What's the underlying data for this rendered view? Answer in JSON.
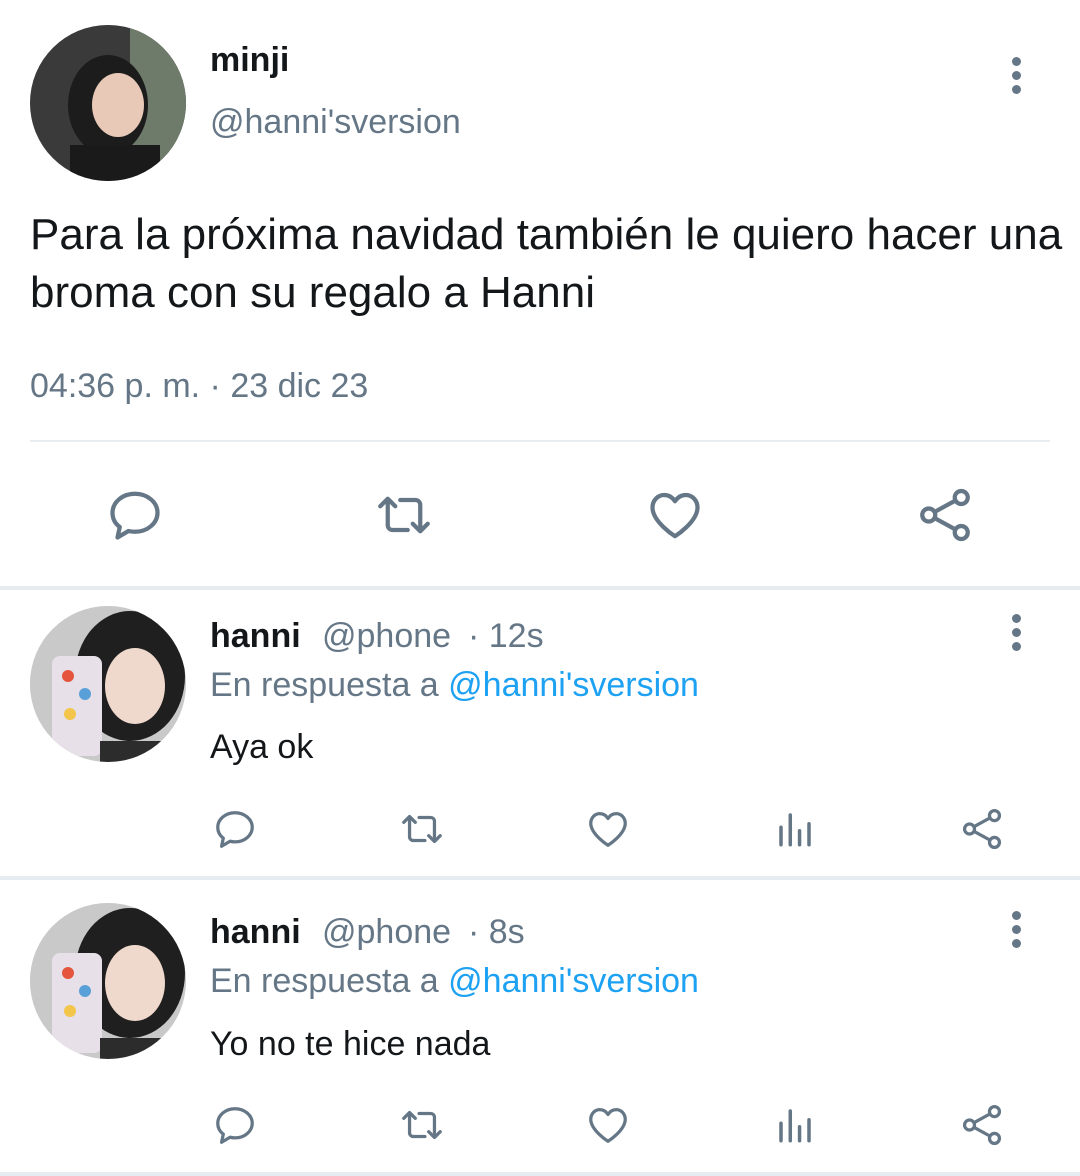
{
  "main_tweet": {
    "display_name": "minji",
    "handle": "@hanni'sversion",
    "text": "Para la próxima navidad también le quiero hacer una broma con su regalo a Hanni",
    "timestamp": "04:36 p. m. · 23 dic 23"
  },
  "replies": [
    {
      "display_name": "hanni",
      "handle": "@phone",
      "time": "· 12s",
      "reply_prefix": "En respuesta a",
      "reply_to": "@hanni'sversion",
      "text": "Aya ok"
    },
    {
      "display_name": "hanni",
      "handle": "@phone",
      "time": "· 8s",
      "reply_prefix": "En respuesta a",
      "reply_to": "@hanni'sversion",
      "text": "Yo no te hice nada"
    }
  ],
  "colors": {
    "text": "#14171a",
    "muted": "#657786",
    "link": "#1da1f2",
    "divider": "#e6ecf0"
  },
  "icons": [
    "reply-icon",
    "retweet-icon",
    "like-icon",
    "analytics-icon",
    "share-icon",
    "more-options-icon"
  ]
}
